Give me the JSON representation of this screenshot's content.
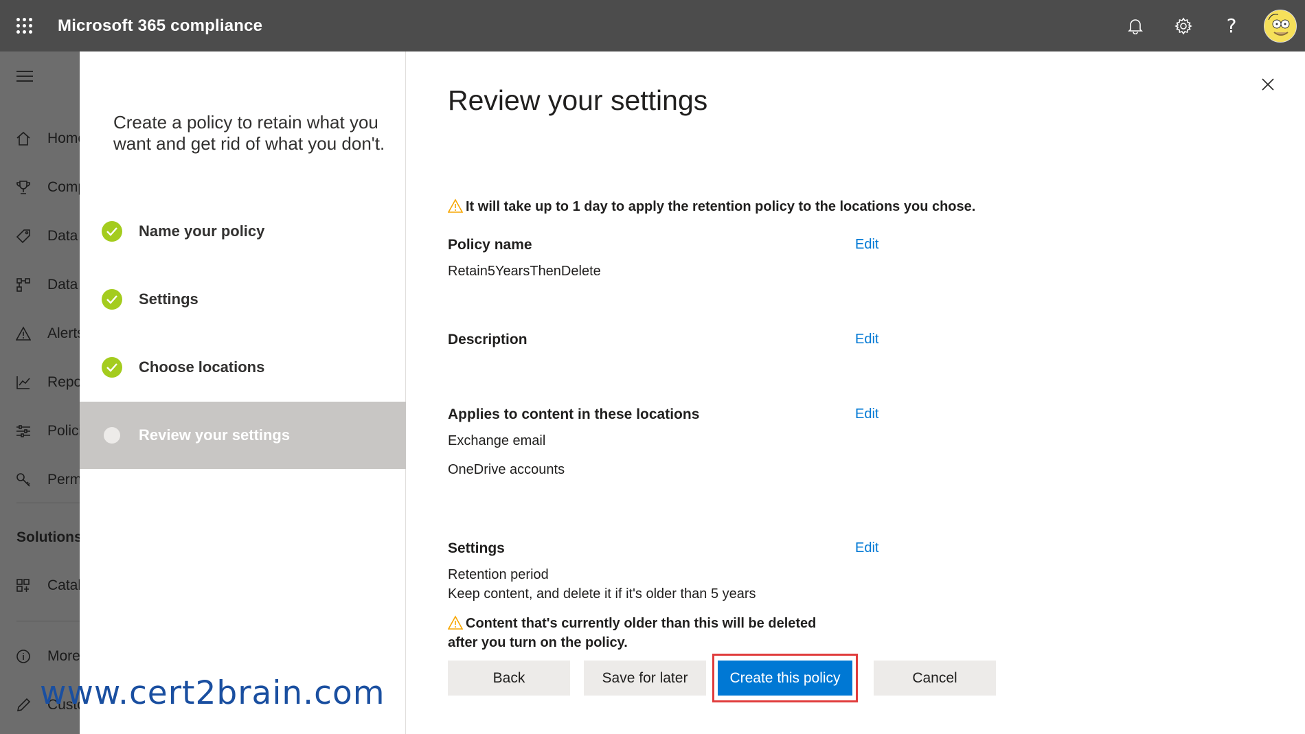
{
  "topbar": {
    "app_title": "Microsoft 365 compliance",
    "icons": [
      "waffle-icon",
      "bell-icon",
      "gear-icon",
      "help-icon",
      "avatar"
    ],
    "help_glyph": "?"
  },
  "leftnav": {
    "items": [
      {
        "label": "Home",
        "icon": "home-icon"
      },
      {
        "label": "Compliance Manager",
        "icon": "trophy-icon"
      },
      {
        "label": "Data classification",
        "icon": "tag-icon"
      },
      {
        "label": "Data connectors",
        "icon": "connector-icon"
      },
      {
        "label": "Alerts",
        "icon": "alert-icon"
      },
      {
        "label": "Reports",
        "icon": "chart-icon"
      },
      {
        "label": "Policies",
        "icon": "sliders-icon"
      },
      {
        "label": "Permissions",
        "icon": "key-icon"
      }
    ],
    "solutions_heading": "Solutions",
    "solutions_items": [
      {
        "label": "Catalog",
        "icon": "catalog-icon"
      }
    ],
    "bottom_items": [
      {
        "label": "More resources",
        "icon": "info-icon"
      },
      {
        "label": "Customize navigation",
        "icon": "pencil-icon"
      }
    ]
  },
  "wizard": {
    "intro": "Create a policy to retain what you want and get rid of what you don't.",
    "steps": [
      {
        "label": "Name your policy",
        "status": "done"
      },
      {
        "label": "Settings",
        "status": "done"
      },
      {
        "label": "Choose locations",
        "status": "done"
      },
      {
        "label": "Review your settings",
        "status": "current"
      }
    ]
  },
  "review": {
    "title": "Review your settings",
    "warning_top": "It will take up to 1 day to apply the retention policy to the locations you chose.",
    "edit_label": "Edit",
    "policy_name": {
      "title": "Policy name",
      "value": "Retain5YearsThenDelete"
    },
    "description": {
      "title": "Description",
      "value": ""
    },
    "locations": {
      "title": "Applies to content in these locations",
      "values": [
        "Exchange email",
        "OneDrive accounts"
      ]
    },
    "settings": {
      "title": "Settings",
      "line1": "Retention period",
      "line2": "Keep content, and delete it if it's older than 5 years",
      "warning_line1": "Content that's currently older than this will be deleted",
      "warning_line2": "after you turn on the policy."
    },
    "buttons": {
      "back": "Back",
      "save_later": "Save for later",
      "create": "Create this policy",
      "cancel": "Cancel"
    }
  },
  "watermark": "www.cert2brain.com",
  "colors": {
    "topbar": "#4c4c4c",
    "accent": "#0078d4",
    "step_done": "#a4cc1e",
    "step_active_bg": "#c8c6c4",
    "warning": "#f7a600",
    "highlight": "#e03c3c"
  }
}
